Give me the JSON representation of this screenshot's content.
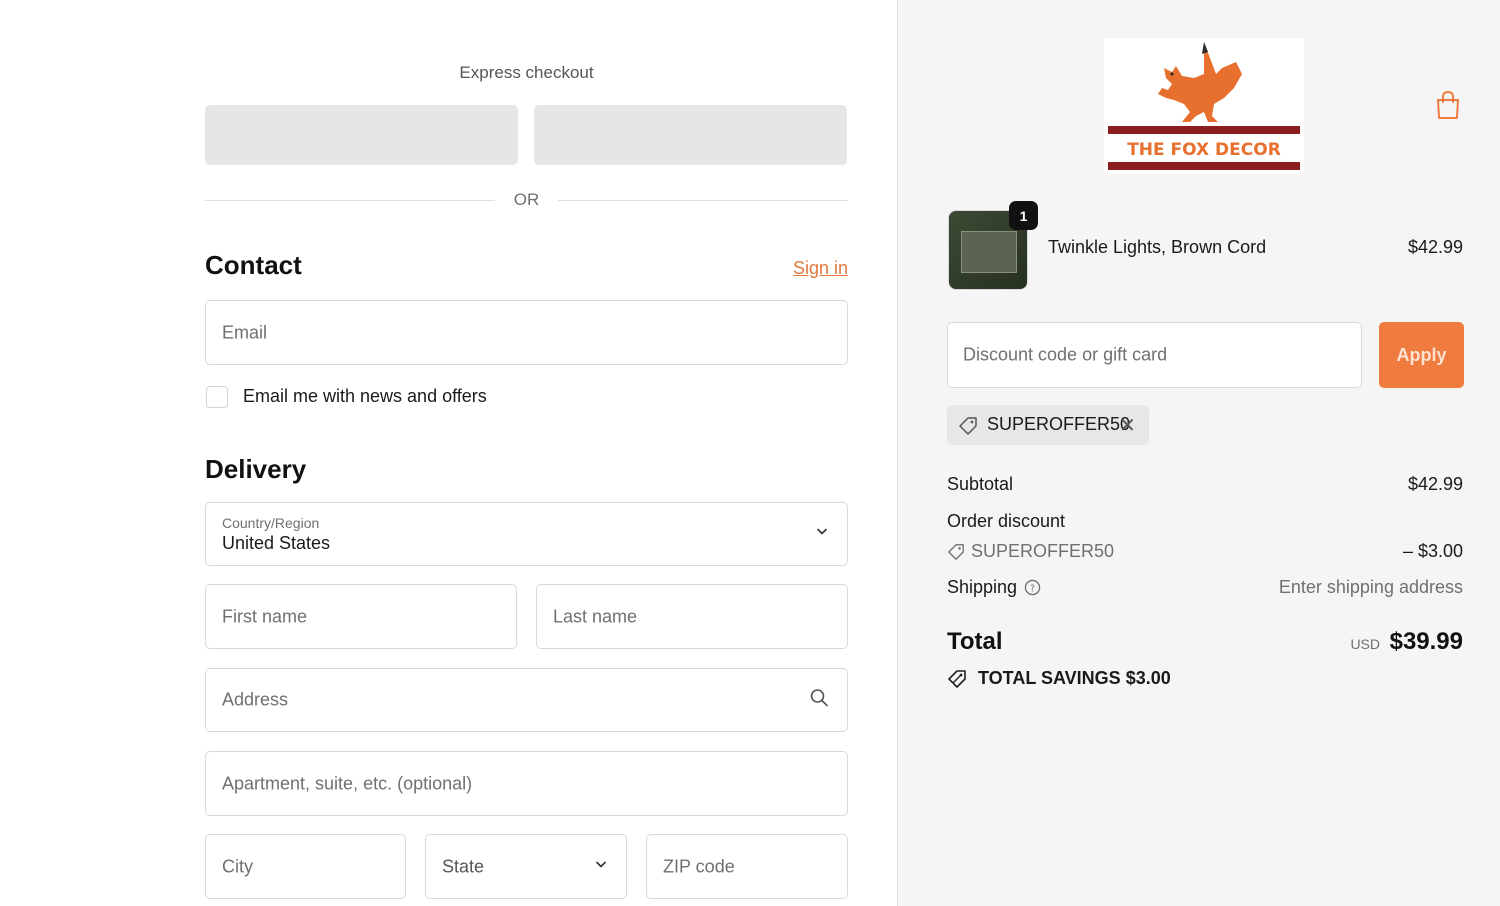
{
  "checkout": {
    "express_title": "Express checkout",
    "or_text": "OR",
    "contact": {
      "heading": "Contact",
      "sign_in": "Sign in",
      "email_placeholder": "Email",
      "newsletter_label": "Email me with news and offers"
    },
    "delivery": {
      "heading": "Delivery",
      "country_label": "Country/Region",
      "country_value": "United States",
      "first_name_placeholder": "First name",
      "last_name_placeholder": "Last name",
      "address_placeholder": "Address",
      "apartment_placeholder": "Apartment, suite, etc. (optional)",
      "city_placeholder": "City",
      "state_placeholder": "State",
      "zip_placeholder": "ZIP code"
    }
  },
  "summary": {
    "brand_name": "THE FOX DECOR",
    "item": {
      "name": "Twinkle Lights, Brown Cord",
      "price": "$42.99",
      "quantity": "1"
    },
    "discount_placeholder": "Discount code or gift card",
    "apply_label": "Apply",
    "applied_code": "SUPEROFFER50",
    "subtotal_label": "Subtotal",
    "subtotal_value": "$42.99",
    "order_discount_label": "Order discount",
    "order_discount_code": "SUPEROFFER50",
    "order_discount_value": "– $3.00",
    "shipping_label": "Shipping",
    "shipping_value": "Enter shipping address",
    "total_label": "Total",
    "currency": "USD",
    "total_value": "$39.99",
    "savings_label": "TOTAL SAVINGS",
    "savings_value": "$3.00"
  },
  "colors": {
    "accent": "#f07b3f",
    "brand_red": "#8b1e1e",
    "brand_orange": "#e8702f"
  }
}
